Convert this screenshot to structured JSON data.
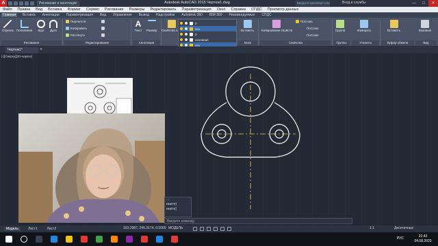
{
  "window": {
    "app_icon": "A",
    "title": "Autodesk AutoCAD 2015   Чертеж1.dwg",
    "workspace": "Рисование и аннотации",
    "search_placeholder": "Введите ключевое слово/фразу",
    "signin": "Вход в службы",
    "min": "—",
    "max": "□",
    "close": "✕"
  },
  "menu": [
    "Файл",
    "Правка",
    "Вид",
    "Вставка",
    "Формат",
    "Сервис",
    "Рисование",
    "Размеры",
    "Редактировать",
    "Параметризация",
    "Окно",
    "Справка",
    "СПДС",
    "Просмотр данных"
  ],
  "ribbon_tabs": [
    "Главная",
    "Вставка",
    "Аннотации",
    "Параметризация",
    "Вид",
    "Управление",
    "Вывод",
    "Надстройки",
    "Autodesk 360",
    "BIM 360",
    "Рекомендуемые",
    "СПДС"
  ],
  "ribbon": {
    "draw": {
      "title": "Рисование",
      "line": "Отрезок",
      "polyline": "Полилиния",
      "circle": "Круг",
      "arc": "Дуга"
    },
    "modify": {
      "title": "Редактирование",
      "move": "Перенести",
      "copy": "Копировать",
      "stretch": "Растянуть"
    },
    "annotation": {
      "title": "Аннотации",
      "text": "Текст",
      "dim": "Размер"
    },
    "layer_props": "Свойства слоя",
    "block": {
      "title": "Блок",
      "insert": "Вставить"
    },
    "props": {
      "title": "Свойства",
      "copy_props": "Копирование свойств",
      "bylayer1": "ПоСлою",
      "bylayer2": "ПоСлою",
      "bylayer3": "ПоСлою"
    },
    "groups": {
      "title": "Группы",
      "group": "Группа"
    },
    "utilities": {
      "title": "Утилиты",
      "measure": "Измерить"
    },
    "clipboard": {
      "title": "Буфер обмена",
      "paste": "Вставить"
    },
    "view": {
      "title": "Вид",
      "base": "Базовый"
    }
  },
  "layers": [
    "0",
    "ось",
    "0",
    "основная",
    "ось",
    "размеры"
  ],
  "document": {
    "tab": "Чертеж1*",
    "plus": "+",
    "viewport": "[-][Сверху][2D-каркас]"
  },
  "command": {
    "line1": "...",
    "line2": "ините]",
    "line3": "ините]",
    "input_placeholder": "Введите команду"
  },
  "layout_tabs": [
    "Модель",
    "Лист1",
    "Лист2"
  ],
  "status": {
    "coords": "163.2987, 245.3174, 0.0000",
    "model": "МОДЕЛЬ",
    "scale": "1:1",
    "units": "Десятичные"
  },
  "taskbar": {
    "lang": "РУС",
    "time": "21:43",
    "date": "04.08.2020"
  },
  "colors": {
    "accent": "#3d6aa8",
    "layer_yellow": "#f0c419",
    "drawing_white": "#ffffff",
    "axis_yellow": "#e6d13c"
  }
}
